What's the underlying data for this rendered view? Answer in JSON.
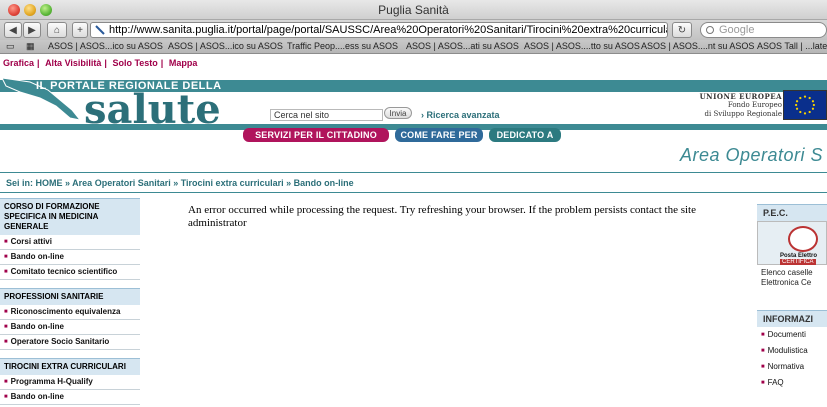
{
  "window": {
    "title": "Puglia Sanità"
  },
  "toolbar": {
    "url": "http://www.sanita.puglia.it/portal/page/portal/SAUSSC/Area%20Operatori%20Sanitari/Tirocini%20extra%20curriculari/Bando%20",
    "search_placeholder": "Google",
    "back_label": "◀",
    "forward_label": "▶",
    "home_label": "⌂",
    "add_label": "+"
  },
  "bookmarks": [
    "ASOS | ASOS...ico su ASOS",
    "ASOS | ASOS...ico su ASOS",
    "Traffic Peop....ess su ASOS",
    "ASOS | ASOS...ati su ASOS",
    "ASOS | ASOS....tto su ASOS",
    "ASOS | ASOS....nt su ASOS",
    "ASOS Tall | ...late"
  ],
  "accessibility_links": [
    "Grafica",
    "Alta Visibilità",
    "Solo Testo",
    "Mappa"
  ],
  "header": {
    "portal_line": "IL PORTALE REGIONALE DELLA",
    "logo_word": "salute",
    "search_value": "Cerca nel sito",
    "search_button": "Invia",
    "advanced_search": "› Ricerca avanzata",
    "ue_lines": [
      "UNIONE EUROPEA",
      "Fondo Europeo",
      "di Sviluppo Regionale"
    ]
  },
  "nav_tabs": [
    "SERVIZI PER IL CITTADINO",
    "COME FARE PER",
    "DEDICATO A"
  ],
  "area_title": "Area Operatori S",
  "breadcrumb": "Sei in: HOME » Area Operatori Sanitari » Tirocini extra curriculari » Bando on-line",
  "sidebar": {
    "sections": [
      {
        "title": "CORSO DI FORMAZIONE SPECIFICA IN MEDICINA GENERALE",
        "items": [
          "Corsi attivi",
          "Bando on-line",
          "Comitato tecnico scientifico"
        ]
      },
      {
        "title": "PROFESSIONI SANITARIE",
        "items": [
          "Riconoscimento equivalenza",
          "Bando on-line",
          "Operatore Socio Sanitario"
        ]
      },
      {
        "title": "TIROCINI EXTRA CURRICULARI",
        "items": [
          "Programma H-Qualify",
          "Bando on-line"
        ]
      }
    ]
  },
  "main": {
    "error_message": "An error occurred while processing the request. Try refreshing your browser. If the problem persists contact the site administrator"
  },
  "right": {
    "pec": {
      "title": "P.E.C.",
      "caption": "Posta Elettro",
      "certif": "CERTIFICA",
      "text_1": "Elenco caselle",
      "text_2": "Elettronica Ce"
    },
    "info": {
      "title": "INFORMAZI",
      "links": [
        "Documenti",
        "Modulistica",
        "Normativa",
        "FAQ"
      ]
    }
  },
  "colors": {
    "teal": "#3d8a93",
    "magenta": "#a0004a",
    "tab_magenta": "#b0145c",
    "tab_blue": "#2f6a9a",
    "tab_teal": "#2c7a80"
  }
}
